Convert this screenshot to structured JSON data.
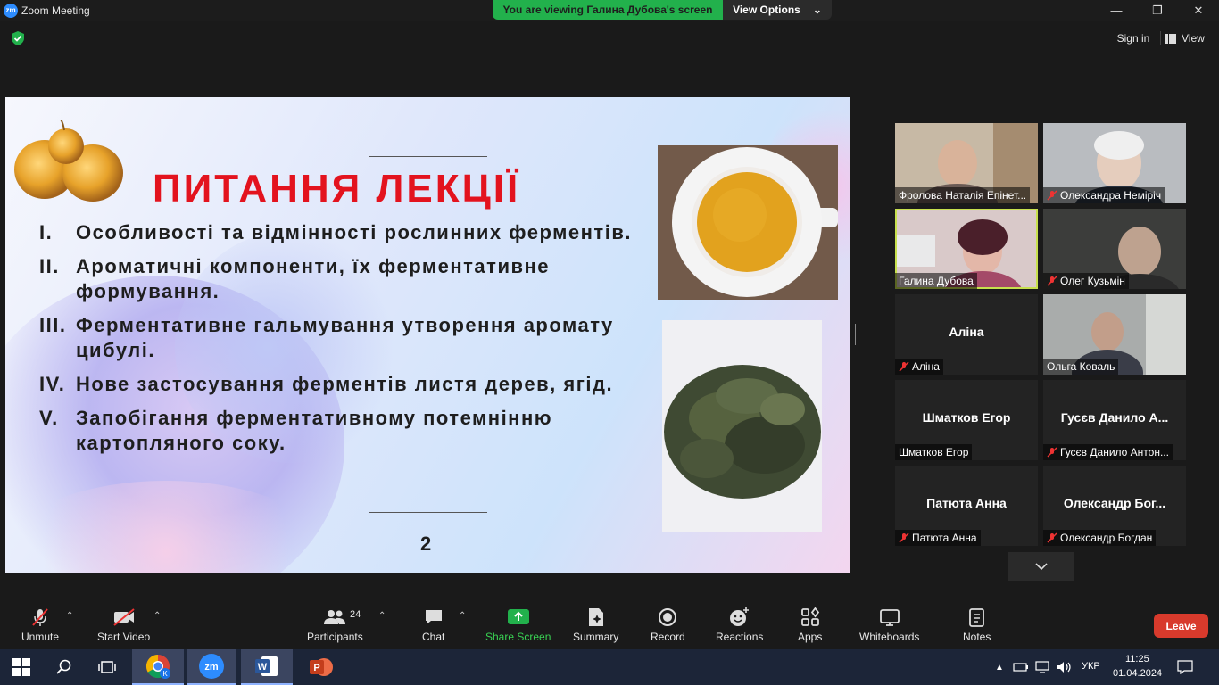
{
  "window": {
    "title": "Zoom Meeting",
    "logo_text": "zm"
  },
  "banner": {
    "text": "You are viewing Галина Дубова's screen",
    "view_options": "View Options"
  },
  "topbar": {
    "sign_in": "Sign in",
    "view": "View"
  },
  "slide": {
    "title": "ПИТАННЯ ЛЕКЦІЇ",
    "items": [
      {
        "num": "I.",
        "text": "Особливості та відмінності рослинних ферментів."
      },
      {
        "num": "II.",
        "text": "Ароматичні компоненти, їх  ферментативне формування."
      },
      {
        "num": "III.",
        "text": "Ферментативне гальмування утворення аромату цибулі."
      },
      {
        "num": "IV.",
        "text": "Нове застосування ферментів листя дерев, ягід."
      },
      {
        "num": "V.",
        "text": "Запобігання ферментативному потемнінню картопляного соку."
      }
    ],
    "page_number": "2"
  },
  "gallery": {
    "tiles": [
      {
        "name": "Фролова Наталія Епінет...",
        "center": "",
        "muted": false,
        "video": true
      },
      {
        "name": "Олександра Немірiч",
        "center": "",
        "muted": true,
        "video": true
      },
      {
        "name": "Галина Дубова",
        "center": "",
        "muted": false,
        "video": true,
        "active": true
      },
      {
        "name": "Олег Кузьмін",
        "center": "",
        "muted": true,
        "video": true
      },
      {
        "name": "Аліна",
        "center": "Аліна",
        "muted": true,
        "video": false
      },
      {
        "name": "Ольга Коваль",
        "center": "",
        "muted": false,
        "video": true
      },
      {
        "name": "Шматков Егор",
        "center": "Шматков Егор",
        "muted": false,
        "video": false
      },
      {
        "name": "Гусєв Данило Антон...",
        "center": "Гусєв Данило А...",
        "muted": true,
        "video": false
      },
      {
        "name": "Патюта Анна",
        "center": "Патюта Анна",
        "muted": true,
        "video": false
      },
      {
        "name": "Олександр Богдан",
        "center": "Олександр  Бог...",
        "muted": true,
        "video": false
      }
    ]
  },
  "toolbar": {
    "unmute": "Unmute",
    "start_video": "Start Video",
    "participants": "Participants",
    "participants_count": "24",
    "chat": "Chat",
    "share_screen": "Share Screen",
    "summary": "Summary",
    "record": "Record",
    "reactions": "Reactions",
    "apps": "Apps",
    "whiteboards": "Whiteboards",
    "notes": "Notes",
    "leave": "Leave"
  },
  "taskbar": {
    "language": "УКР",
    "time": "11:25",
    "date": "01.04.2024",
    "chrome_badge": "K",
    "zoom_label": "zm",
    "word_label": "W",
    "ppt_label": "P"
  },
  "colors": {
    "share_green": "#22b14c",
    "leave_red": "#d83a2c",
    "active_speaker": "#c7e04d",
    "slide_title_red": "#e3131e"
  },
  "icons": [
    "shield-icon",
    "windows-start-icon",
    "search-icon",
    "task-view-icon",
    "chrome-icon",
    "zoom-icon",
    "word-icon",
    "powerpoint-icon",
    "microphone-muted-icon",
    "video-off-icon",
    "participants-icon",
    "chat-icon",
    "share-screen-icon",
    "summary-icon",
    "record-icon",
    "reactions-icon",
    "apps-icon",
    "whiteboards-icon",
    "notes-icon",
    "chevron-down-icon",
    "notification-icon"
  ]
}
